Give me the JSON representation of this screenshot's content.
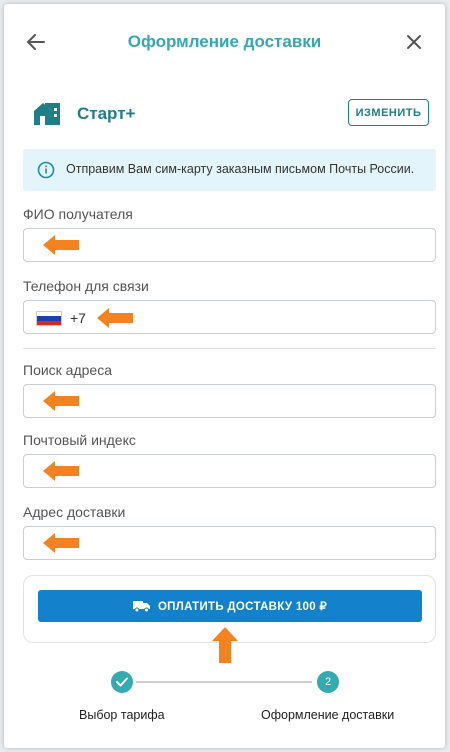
{
  "header": {
    "title": "Оформление доставки"
  },
  "tariff": {
    "name": "Старт+",
    "change_label": "ИЗМЕНИТЬ"
  },
  "info": {
    "text": "Отправим Вам сим-карту заказным письмом Почты России."
  },
  "form": {
    "fio_label": "ФИО получателя",
    "phone_label": "Телефон для связи",
    "phone_prefix": "+7",
    "address_search_label": "Поиск адреса",
    "postal_code_label": "Почтовый индекс",
    "delivery_address_label": "Адрес доставки"
  },
  "payment": {
    "button_label": "ОПЛАТИТЬ ДОСТАВКУ 100 ₽"
  },
  "steps": {
    "step1_label": "Выбор тарифа",
    "step2_number": "2",
    "step2_label": "Оформление доставки"
  },
  "colors": {
    "accent": "#34a9b1",
    "primary_button": "#1381cb",
    "annotation_arrow": "#f58220",
    "info_bg": "#e4f4fb"
  },
  "icons": {
    "back": "arrow-left-icon",
    "close": "close-icon",
    "tariff": "house-icon",
    "info": "info-icon",
    "flag": "russia-flag-icon",
    "truck": "truck-icon",
    "check": "check-icon",
    "annotation": "orange-arrow-icon"
  }
}
